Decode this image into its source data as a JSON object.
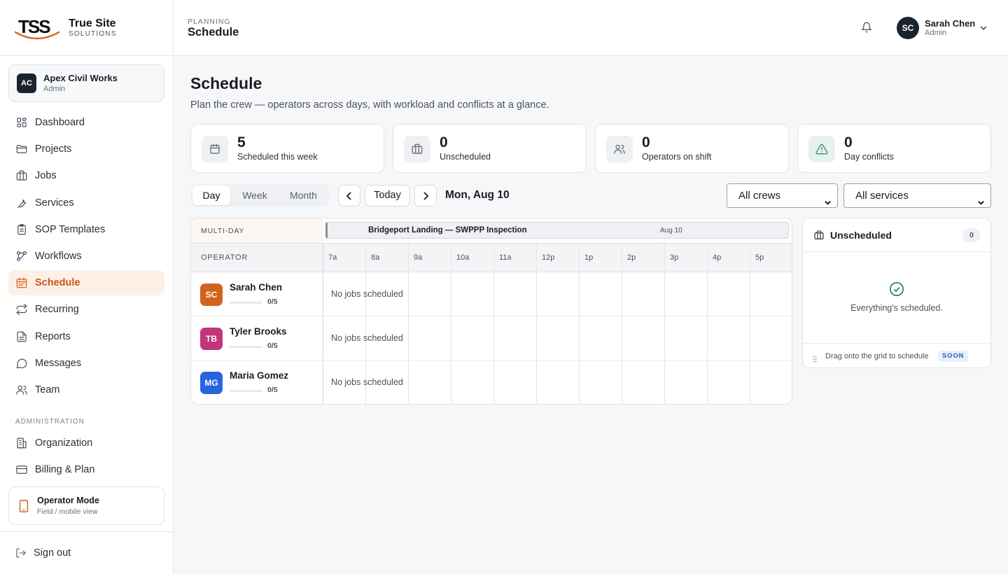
{
  "brand": {
    "logo": "TSS",
    "name": "True Site",
    "sub": "SOLUTIONS"
  },
  "org": {
    "initials": "AC",
    "name": "Apex Civil Works",
    "role": "Admin"
  },
  "nav": {
    "items": [
      {
        "label": "Dashboard",
        "icon": "dashboard-icon"
      },
      {
        "label": "Projects",
        "icon": "folder-icon"
      },
      {
        "label": "Jobs",
        "icon": "briefcase-icon"
      },
      {
        "label": "Services",
        "icon": "wrench-icon"
      },
      {
        "label": "SOP Templates",
        "icon": "clipboard-icon"
      },
      {
        "label": "Workflows",
        "icon": "workflow-icon"
      },
      {
        "label": "Schedule",
        "icon": "calendar-icon",
        "active": true
      },
      {
        "label": "Recurring",
        "icon": "repeat-icon"
      },
      {
        "label": "Reports",
        "icon": "report-icon"
      },
      {
        "label": "Messages",
        "icon": "message-icon"
      },
      {
        "label": "Team",
        "icon": "team-icon"
      }
    ],
    "admin_heading": "ADMINISTRATION",
    "admin_items": [
      {
        "label": "Organization",
        "icon": "building-icon"
      },
      {
        "label": "Billing & Plan",
        "icon": "credit-card-icon"
      }
    ]
  },
  "operator_mode": {
    "title": "Operator Mode",
    "sub": "Field / mobile view"
  },
  "sign_out": "Sign out",
  "topbar": {
    "crumb": "PLANNING",
    "title": "Schedule",
    "user": {
      "initials": "SC",
      "name": "Sarah Chen",
      "role": "Admin"
    }
  },
  "page": {
    "title": "Schedule",
    "subtitle": "Plan the crew — operators across days, with workload and conflicts at a glance."
  },
  "stats": [
    {
      "value": "5",
      "caption": "Scheduled this week",
      "icon": "calendar-icon"
    },
    {
      "value": "0",
      "caption": "Unscheduled",
      "icon": "briefcase-icon"
    },
    {
      "value": "0",
      "caption": "Operators on shift",
      "icon": "team-icon"
    },
    {
      "value": "0",
      "caption": "Day conflicts",
      "icon": "warning-icon"
    }
  ],
  "toolbar": {
    "views": [
      "Day",
      "Week",
      "Month"
    ],
    "active_view": "Day",
    "today": "Today",
    "date": "Mon, Aug 10",
    "crew_filter": "All crews",
    "service_filter": "All services"
  },
  "grid": {
    "multiday_label": "MULTI-DAY",
    "multiday_job": {
      "title": "Bridgeport Landing — SWPPP Inspection",
      "date": "Aug 10"
    },
    "operator_header": "OPERATOR",
    "hours": [
      "7a",
      "8a",
      "9a",
      "10a",
      "11a",
      "12p",
      "1p",
      "2p",
      "3p",
      "4p",
      "5p"
    ],
    "operators": [
      {
        "initials": "SC",
        "name": "Sarah Chen",
        "load": "0/5",
        "load_fraction": 0,
        "color": "#d4621f",
        "empty_text": "No jobs scheduled"
      },
      {
        "initials": "TB",
        "name": "Tyler Brooks",
        "load": "0/5",
        "load_fraction": 0,
        "color": "#c2357a",
        "empty_text": "No jobs scheduled"
      },
      {
        "initials": "MG",
        "name": "Maria Gomez",
        "load": "0/5",
        "load_fraction": 0,
        "color": "#2a63e0",
        "empty_text": "No jobs scheduled"
      }
    ]
  },
  "unscheduled": {
    "title": "Unscheduled",
    "count": "0",
    "empty_message": "Everything's scheduled.",
    "footer": "Drag onto the grid to schedule",
    "badge": "SOON"
  },
  "colors": {
    "accent": "#d4621f",
    "active_bg": "#fdf0e7",
    "success": "#2f7a5b"
  }
}
